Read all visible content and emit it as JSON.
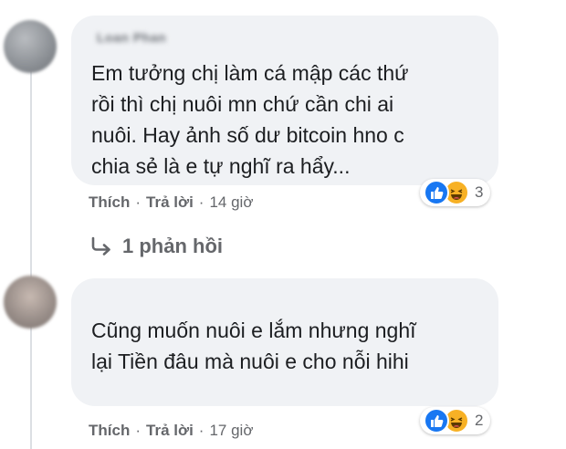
{
  "comments": [
    {
      "author": "Loan Phan",
      "text": "Em tưởng chị làm cá mập các thứ\nrồi thì chị nuôi mn chứ cần chi ai\nnuôi. Hay ảnh số dư bitcoin hno c\nchia sẻ là e tự nghĩ ra hẩy...",
      "like_label": "Thích",
      "reply_label": "Trả lời",
      "time": "14 giờ",
      "reaction_count": "3",
      "reactions": [
        "like-icon",
        "haha-icon"
      ]
    },
    {
      "author": "",
      "author_sub": "",
      "text": "Cũng muốn nuôi e lắm nhưng nghĩ\nlại Tiền đâu mà nuôi e cho nỗi hihi",
      "like_label": "Thích",
      "reply_label": "Trả lời",
      "time": "17 giờ",
      "reaction_count": "2",
      "reactions": [
        "like-icon",
        "haha-icon"
      ]
    }
  ],
  "replies_link": "1 phản hồi",
  "colors": {
    "bubble_bg": "#f0f2f5",
    "secondary_text": "#65676b",
    "like_blue": "#1877f2",
    "haha_yellow": "#f7b125"
  }
}
